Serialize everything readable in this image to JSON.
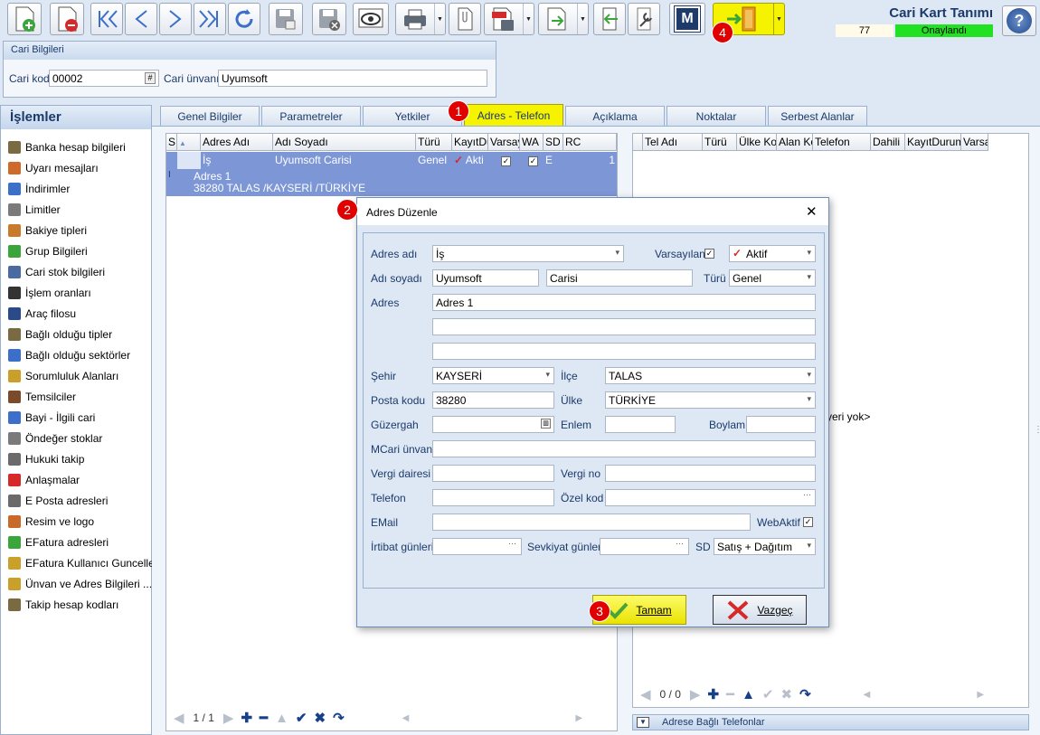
{
  "toolbar": {
    "icons": [
      "new-record-icon",
      "delete-record-icon",
      "first-record-icon",
      "previous-record-icon",
      "next-record-icon",
      "last-record-icon",
      "refresh-icon",
      "save-icon",
      "cancel-save-icon",
      "preview-icon",
      "print-icon",
      "attachment-icon",
      "pdf-export-icon",
      "export-icon",
      "import-icon",
      "tools-icon",
      "m-icon",
      "exit-icon",
      "help-icon"
    ],
    "m_label": "M",
    "help_label": "?"
  },
  "header": {
    "title": "Cari Kart Tanımı",
    "record_no": "77",
    "status": "Onaylandı",
    "status_color": "#22e022"
  },
  "cari": {
    "group_title": "Cari Bilgileri",
    "kod_label": "Cari kod",
    "kod_value": "00002",
    "unvan_label": "Cari ünvanı",
    "unvan_value": "Uyumsoft"
  },
  "sidebar": {
    "title": "İşlemler",
    "items": [
      {
        "label": "Banka hesap bilgileri",
        "icon": "bank-icon"
      },
      {
        "label": "Uyarı mesajları",
        "icon": "warning-icon"
      },
      {
        "label": "İndirimler",
        "icon": "discount-icon"
      },
      {
        "label": "Limitler",
        "icon": "limit-icon"
      },
      {
        "label": "Bakiye tipleri",
        "icon": "balance-icon"
      },
      {
        "label": "Grup Bilgileri",
        "icon": "group-icon"
      },
      {
        "label": "Cari stok bilgileri",
        "icon": "stock-icon"
      },
      {
        "label": "İşlem oranları",
        "icon": "percent-icon"
      },
      {
        "label": "Araç filosu",
        "icon": "vehicle-icon"
      },
      {
        "label": "Bağlı olduğu tipler",
        "icon": "type-icon"
      },
      {
        "label": "Bağlı olduğu sektörler",
        "icon": "sector-icon"
      },
      {
        "label": "Sorumluluk Alanları",
        "icon": "responsibility-icon"
      },
      {
        "label": "Temsilciler",
        "icon": "representative-icon"
      },
      {
        "label": "Bayi - İlgili cari",
        "icon": "dealer-icon"
      },
      {
        "label": "Öndeğer stoklar",
        "icon": "default-stock-icon"
      },
      {
        "label": "Hukuki takip",
        "icon": "legal-icon"
      },
      {
        "label": "Anlaşmalar",
        "icon": "agreement-icon"
      },
      {
        "label": "E Posta adresleri",
        "icon": "email-icon"
      },
      {
        "label": "Resim ve logo",
        "icon": "image-icon"
      },
      {
        "label": "EFatura adresleri",
        "icon": "einvoice-icon"
      },
      {
        "label": "EFatura Kullanıcı Guncelle",
        "icon": "einvoice-user-icon"
      },
      {
        "label": "Ünvan ve Adres Bilgileri ...",
        "icon": "address-info-icon"
      },
      {
        "label": "Takip hesap kodları",
        "icon": "tracking-icon"
      }
    ]
  },
  "tabs": [
    "Genel Bilgiler",
    "Parametreler",
    "Yetkiler",
    "Adres - Telefon",
    "Açıklama",
    "Noktalar",
    "Serbest Alanlar"
  ],
  "badges": [
    "1",
    "2",
    "3",
    "4"
  ],
  "address_grid": {
    "columns": [
      "S",
      "Adres Adı",
      "Adı Soyadı",
      "Türü",
      "KayıtDu",
      "Varsay",
      "WA",
      "SD",
      "RC"
    ],
    "row": {
      "adres_adi": "İş",
      "adi_soyadi": "Uyumsoft Carisi",
      "turu": "Genel",
      "kayit": "Akti",
      "sd": "E",
      "rc": "1"
    },
    "preview_line1": "Adres 1",
    "preview_line2": "38280     TALAS /KAYSERİ /TÜRKİYE",
    "row_marker": "I",
    "pager": "1 / 1"
  },
  "phone_grid": {
    "columns": [
      "",
      "Tel Adı",
      "Türü",
      "Ülke Koc",
      "Alan Ko",
      "Telefon",
      "Dahili",
      "KayıtDurumu",
      "Varsa"
    ],
    "empty_text": "yeri yok>",
    "pager": "0 / 0",
    "footer": "Adrese Bağlı Telefonlar"
  },
  "dialog": {
    "title": "Adres Düzenle",
    "close": "✕",
    "fields": {
      "adres_adi": {
        "label": "Adres adı",
        "value": "İş"
      },
      "varsayilan": {
        "label": "Varsayılan",
        "checked": "✓"
      },
      "kayit": {
        "value": "Aktif"
      },
      "adi_soyadi": {
        "label": "Adı soyadı",
        "ad": "Uyumsoft",
        "soyad": "Carisi"
      },
      "turu": {
        "label": "Türü",
        "value": "Genel"
      },
      "adres": {
        "label": "Adres",
        "line1": "Adres 1",
        "line2": "",
        "line3": ""
      },
      "sehir": {
        "label": "Şehir",
        "value": "KAYSERİ"
      },
      "ilce": {
        "label": "İlçe",
        "value": "TALAS"
      },
      "posta_kodu": {
        "label": "Posta kodu",
        "value": "38280"
      },
      "ulke": {
        "label": "Ülke",
        "value": "TÜRKİYE"
      },
      "guzergah": {
        "label": "Güzergah",
        "value": ""
      },
      "enlem": {
        "label": "Enlem",
        "value": ""
      },
      "boylam": {
        "label": "Boylam",
        "value": ""
      },
      "mcari": {
        "label": "MCari ünvanı",
        "value": ""
      },
      "vergi_dairesi": {
        "label": "Vergi dairesi",
        "value": ""
      },
      "vergi_no": {
        "label": "Vergi no",
        "value": ""
      },
      "telefon": {
        "label": "Telefon",
        "value": ""
      },
      "ozel_kod": {
        "label": "Özel kod",
        "value": ""
      },
      "email": {
        "label": "EMail",
        "value": ""
      },
      "webaktif": {
        "label": "WebAktif",
        "checked": "✓"
      },
      "irtibat": {
        "label": "İrtibat günleri",
        "value": ""
      },
      "sevkiyat": {
        "label": "Sevkiyat günleri",
        "value": ""
      },
      "sd": {
        "label": "SD",
        "value": "Satış + Dağıtım"
      }
    },
    "ok_label": "Tamam",
    "cancel_label": "Vazgeç"
  }
}
